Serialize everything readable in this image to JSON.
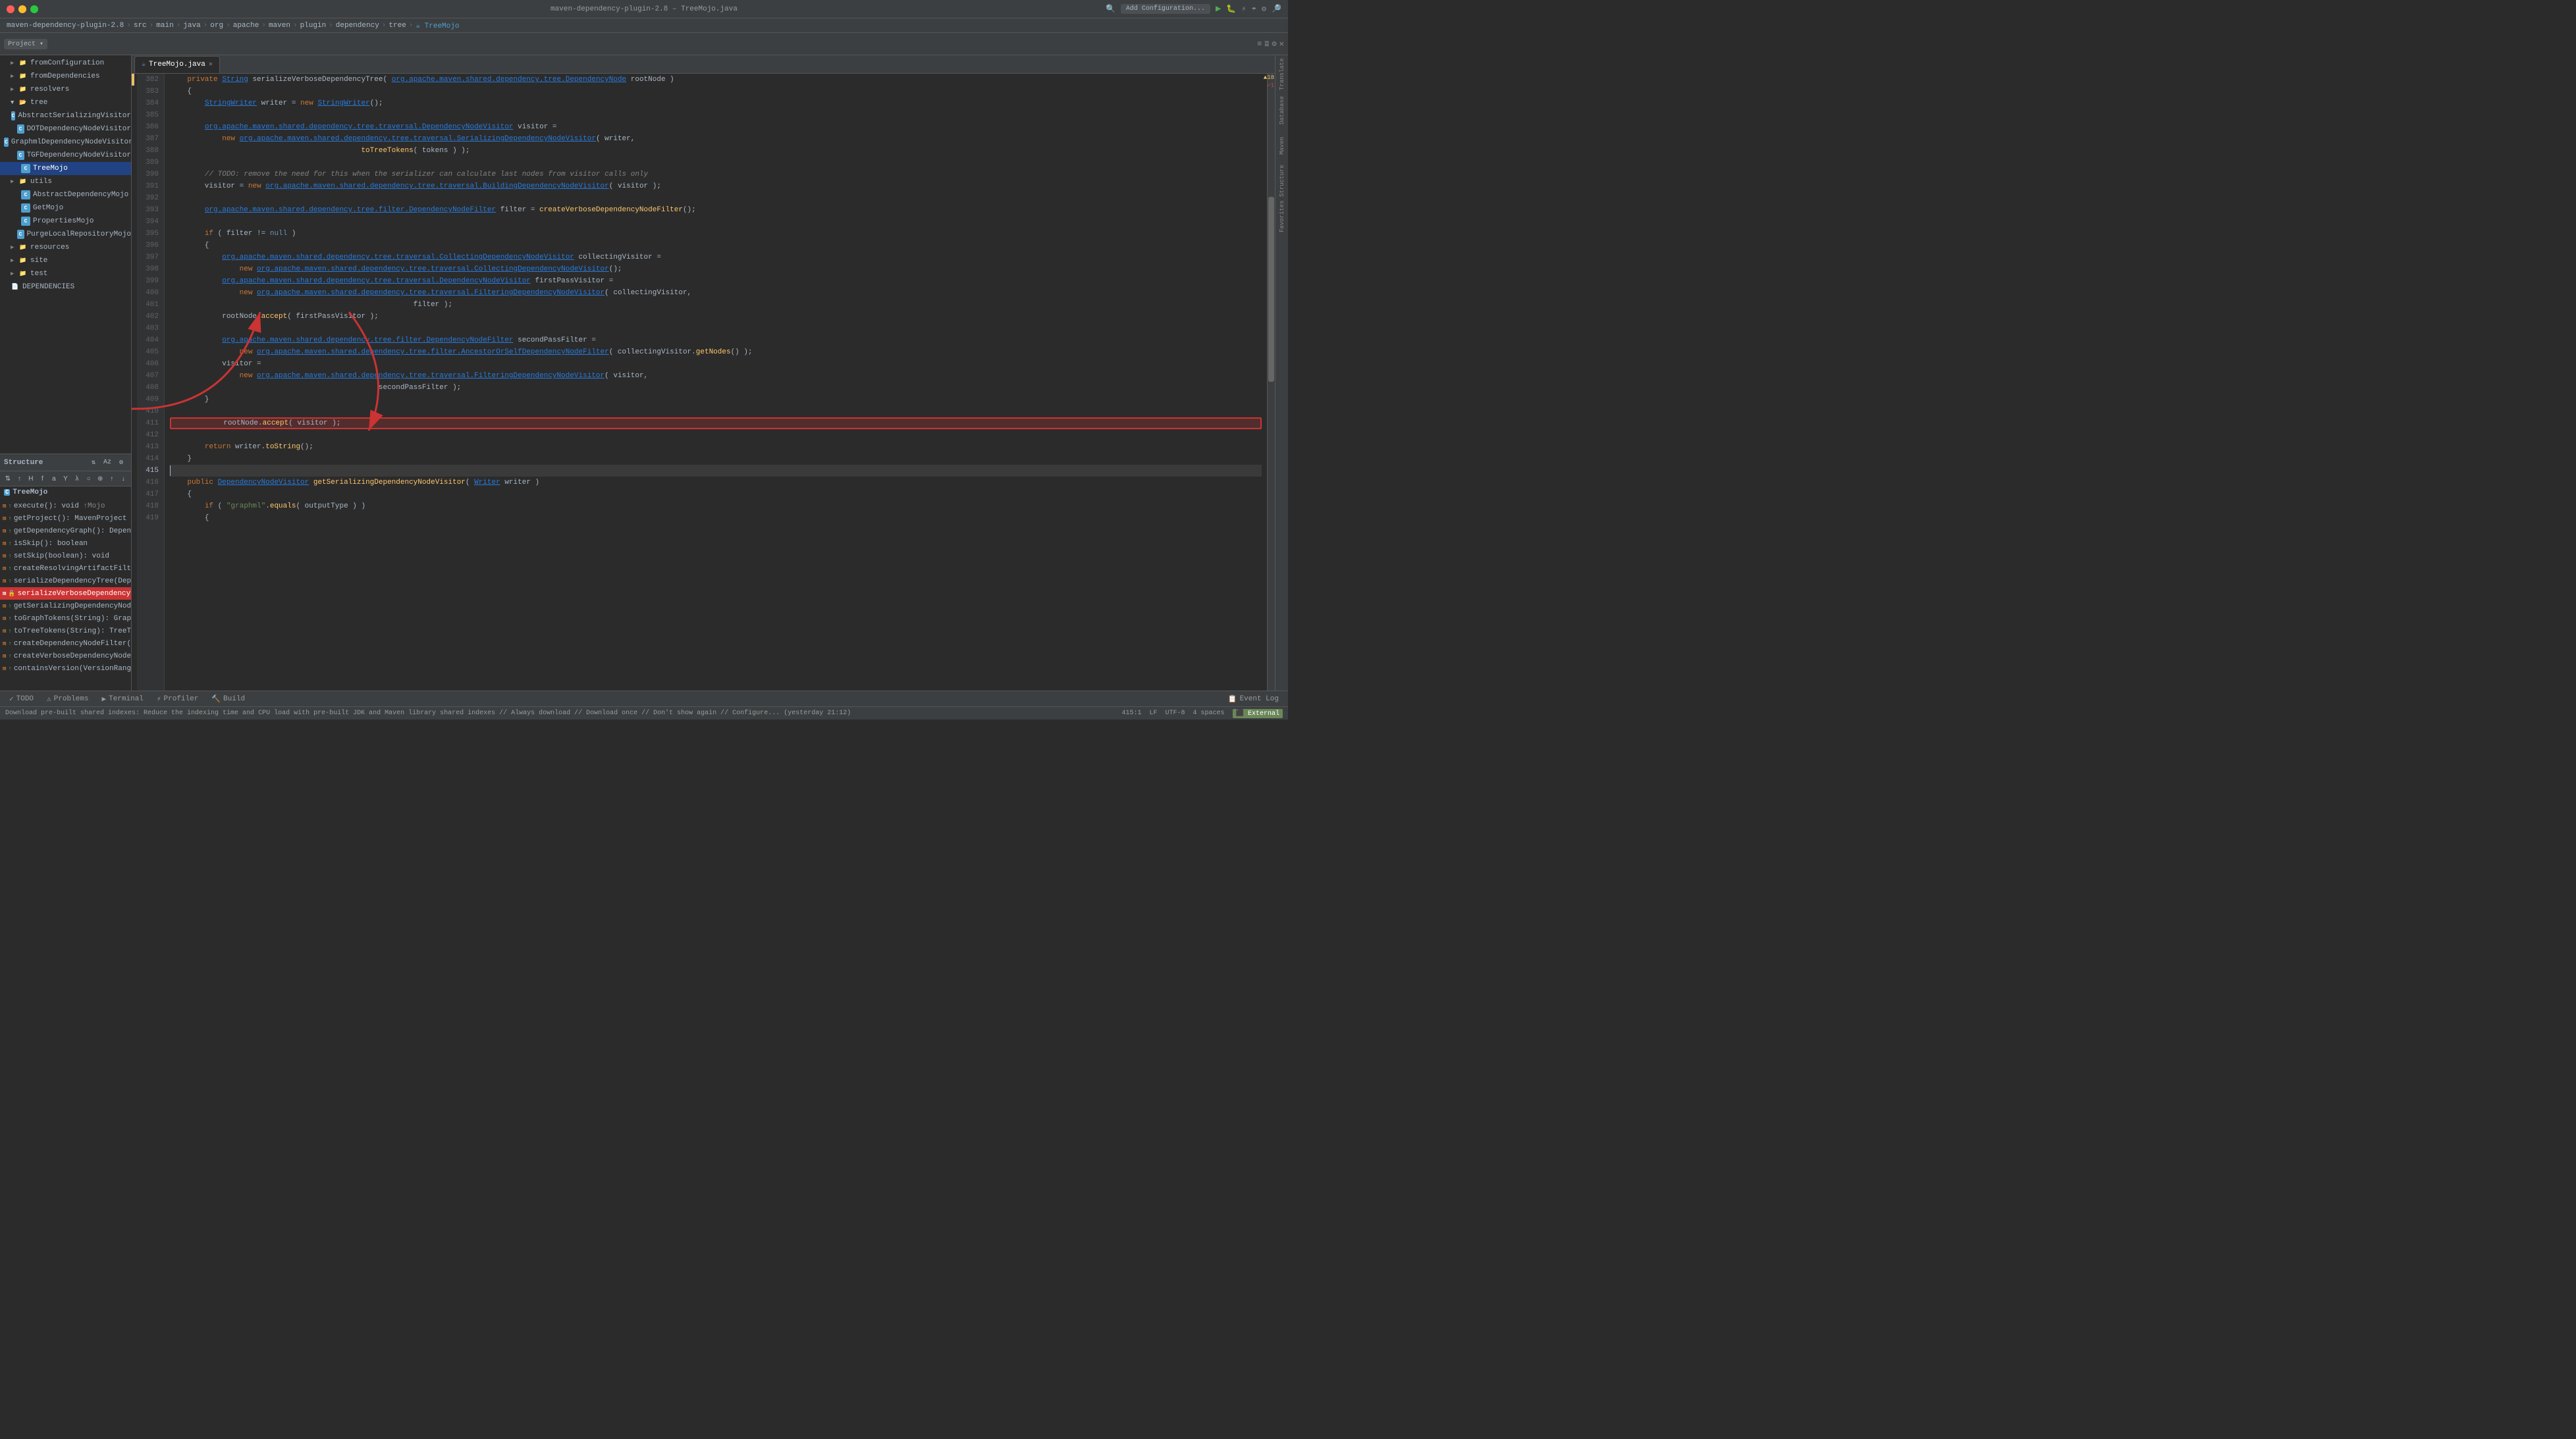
{
  "window": {
    "title": "maven-dependency-plugin-2.8 – TreeMojo.java",
    "trafficLights": [
      "close",
      "minimize",
      "maximize"
    ]
  },
  "breadcrumb": {
    "items": [
      "maven-dependency-plugin-2.8",
      "src",
      "main",
      "java",
      "org",
      "apache",
      "maven",
      "plugin",
      "dependency",
      "tree",
      "TreeMojo"
    ]
  },
  "tabs": [
    {
      "label": "TreeMojo.java",
      "active": true,
      "icon": "J"
    }
  ],
  "toolbar": {
    "addConfig": "Add Configuration...",
    "runLabel": "Run",
    "debugLabel": "Debug"
  },
  "projectPanel": {
    "title": "Project",
    "items": [
      {
        "indent": 1,
        "type": "folder",
        "label": "fromConfiguration",
        "expanded": false
      },
      {
        "indent": 1,
        "type": "folder",
        "label": "fromDependencies",
        "expanded": false
      },
      {
        "indent": 1,
        "type": "folder",
        "label": "resolvers",
        "expanded": false
      },
      {
        "indent": 1,
        "type": "folder",
        "label": "tree",
        "expanded": true
      },
      {
        "indent": 2,
        "type": "class",
        "label": "AbstractSerializingVisitor"
      },
      {
        "indent": 2,
        "type": "class",
        "label": "DOTDependencyNodeVisitor"
      },
      {
        "indent": 2,
        "type": "class",
        "label": "GraphmlDependencyNodeVisitor"
      },
      {
        "indent": 2,
        "type": "class",
        "label": "TGFDependencyNodeVisitor"
      },
      {
        "indent": 2,
        "type": "class",
        "label": "TreeMojo",
        "selected": true
      },
      {
        "indent": 1,
        "type": "folder",
        "label": "utils",
        "expanded": false
      },
      {
        "indent": 2,
        "type": "class",
        "label": "AbstractDependencyMojo"
      },
      {
        "indent": 2,
        "type": "class",
        "label": "GetMojo"
      },
      {
        "indent": 2,
        "type": "class",
        "label": "PropertiesMojo"
      },
      {
        "indent": 2,
        "type": "class",
        "label": "PurgeLocalRepositoryMojo"
      },
      {
        "indent": 1,
        "type": "folder",
        "label": "resources",
        "expanded": false
      },
      {
        "indent": 1,
        "type": "folder",
        "label": "site",
        "expanded": false
      },
      {
        "indent": 1,
        "type": "folder",
        "label": "test",
        "expanded": false
      },
      {
        "indent": 1,
        "type": "file",
        "label": "DEPENDENCIES"
      }
    ]
  },
  "structurePanel": {
    "title": "Structure",
    "className": "TreeMojo",
    "items": [
      {
        "label": "execute(): void",
        "modifier": "public",
        "suffix": "↑Mojo"
      },
      {
        "label": "getProject(): MavenProject",
        "modifier": "public",
        "suffix": ""
      },
      {
        "label": "getDependencyGraph(): DependencyNode",
        "modifier": "public",
        "suffix": ""
      },
      {
        "label": "isSkip(): boolean",
        "modifier": "public",
        "suffix": ""
      },
      {
        "label": "setSkip(boolean): void",
        "modifier": "public",
        "suffix": ""
      },
      {
        "label": "createResolvingArtifactFilter(): ArtifactFilter",
        "modifier": "public",
        "suffix": ""
      },
      {
        "label": "serializeDependencyTree(DependencyNode): String",
        "modifier": "public",
        "suffix": ""
      },
      {
        "label": "serializeVerboseDependencyTree(DependencyNode): Strin",
        "modifier": "private",
        "suffix": "",
        "selected": true
      },
      {
        "label": "getSerializingDependencyNodeVisitor(Writer): DependencyN",
        "modifier": "public",
        "suffix": ""
      },
      {
        "label": "toGraphTokens(String): GraphTokens",
        "modifier": "public",
        "suffix": ""
      },
      {
        "label": "toTreeTokens(String): TreeTokens",
        "modifier": "public",
        "suffix": ""
      },
      {
        "label": "createDependencyNodeFilter(): DependencyNodeFilter",
        "modifier": "public",
        "suffix": ""
      },
      {
        "label": "createVerboseDependencyNodeFilter(): DependencyNodeFi",
        "modifier": "public",
        "suffix": ""
      },
      {
        "label": "containsVersion(VersionRange, ArtifactVersion): boolean",
        "modifier": "public",
        "suffix": ""
      }
    ]
  },
  "editor": {
    "filename": "TreeMojo.java",
    "lines": [
      {
        "num": 382,
        "content": "    private String serializeVerboseDependencyTree( org.apache.maven.shared.dependency.tree.DependencyNode rootNode )"
      },
      {
        "num": 383,
        "content": "    {"
      },
      {
        "num": 384,
        "content": "        StringWriter writer = new StringWriter();"
      },
      {
        "num": 385,
        "content": ""
      },
      {
        "num": 386,
        "content": "        org.apache.maven.shared.dependency.tree.traversal.DependencyNodeVisitor visitor ="
      },
      {
        "num": 387,
        "content": "            new org.apache.maven.shared.dependency.tree.traversal.SerializingDependencyNodeVisitor( writer,"
      },
      {
        "num": 388,
        "content": "                                                                            toTreeTokens( tokens ) );"
      },
      {
        "num": 389,
        "content": ""
      },
      {
        "num": 390,
        "content": "        // TODO: remove the need for this when the serializer can calculate last nodes from visitor calls only"
      },
      {
        "num": 391,
        "content": "        visitor = new org.apache.maven.shared.dependency.tree.traversal.BuildingDependencyNodeVisitor( visitor );"
      },
      {
        "num": 392,
        "content": ""
      },
      {
        "num": 393,
        "content": "        org.apache.maven.shared.dependency.tree.filter.DependencyNodeFilter filter = createVerboseDependencyNodeFilter();"
      },
      {
        "num": 394,
        "content": ""
      },
      {
        "num": 395,
        "content": "        if ( filter != null )"
      },
      {
        "num": 396,
        "content": "        {"
      },
      {
        "num": 397,
        "content": "            org.apache.maven.shared.dependency.tree.traversal.CollectingDependencyNodeVisitor collectingVisitor ="
      },
      {
        "num": 398,
        "content": "                new org.apache.maven.shared.dependency.tree.traversal.CollectingDependencyNodeVisitor();"
      },
      {
        "num": 399,
        "content": "            org.apache.maven.shared.dependency.tree.traversal.DependencyNodeVisitor firstPassVisitor ="
      },
      {
        "num": 400,
        "content": "                new org.apache.maven.shared.dependency.tree.traversal.FilteringDependencyNodeVisitor( collectingVisitor,"
      },
      {
        "num": 401,
        "content": "                                                                                    filter );"
      },
      {
        "num": 402,
        "content": "            rootNode.accept( firstPassVisitor );"
      },
      {
        "num": 403,
        "content": ""
      },
      {
        "num": 404,
        "content": "            org.apache.maven.shared.dependency.tree.filter.DependencyNodeFilter secondPassFilter ="
      },
      {
        "num": 405,
        "content": "                new org.apache.maven.shared.dependency.tree.filter.AncestorOrSelfDependencyNodeFilter( collectingVisitor.getNodes() );"
      },
      {
        "num": 406,
        "content": "            visitor ="
      },
      {
        "num": 407,
        "content": "                new org.apache.maven.shared.dependency.tree.traversal.FilteringDependencyNodeVisitor( visitor,"
      },
      {
        "num": 408,
        "content": "                                                                            secondPassFilter );"
      },
      {
        "num": 409,
        "content": "        }"
      },
      {
        "num": 410,
        "content": ""
      },
      {
        "num": 411,
        "content": "            rootNode.accept( visitor );",
        "boxed": true
      },
      {
        "num": 412,
        "content": ""
      },
      {
        "num": 413,
        "content": "        return writer.toString();"
      },
      {
        "num": 414,
        "content": "    }"
      },
      {
        "num": 415,
        "content": ""
      },
      {
        "num": 416,
        "content": "    public DependencyNodeVisitor getSerializingDependencyNodeVisitor( Writer writer )"
      },
      {
        "num": 417,
        "content": "    {"
      },
      {
        "num": 418,
        "content": "        if ( \"graphml\".equals( outputType ) )"
      },
      {
        "num": 419,
        "content": "        {"
      }
    ],
    "cursor": {
      "line": 415,
      "col": 1
    }
  },
  "statusBar": {
    "left": "TODO  Problems  Terminal  Profiler  Build",
    "position": "415:1",
    "encoding": "LF  UTF-8",
    "indent": "4 spaces",
    "external": "External",
    "warnings": "18",
    "errors": "1",
    "message": "Download pre-built shared indexes: Reduce the indexing time and CPU load with pre-built JDK and Maven library shared indexes // Always download // Download once // Don't show again // Configure... (yesterday 21:12)"
  },
  "rightSidebar": {
    "items": [
      "Translate",
      "Database",
      "Maven",
      "Structure",
      "Favorites"
    ]
  }
}
